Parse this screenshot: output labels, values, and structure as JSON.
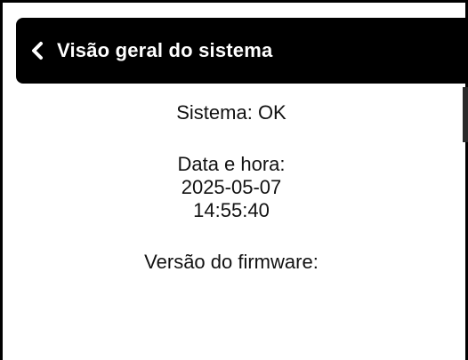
{
  "header": {
    "back_icon": "chevron-left-icon",
    "title": "Visão geral do sistema"
  },
  "overview": {
    "system_status": "Sistema: OK",
    "datetime_label": "Data e hora:",
    "date": "2025-05-07",
    "time": "14:55:40",
    "firmware_label": "Versão do firmware:"
  },
  "colors": {
    "header_bg": "#000000",
    "header_text": "#ffffff",
    "body_text": "#111111"
  }
}
